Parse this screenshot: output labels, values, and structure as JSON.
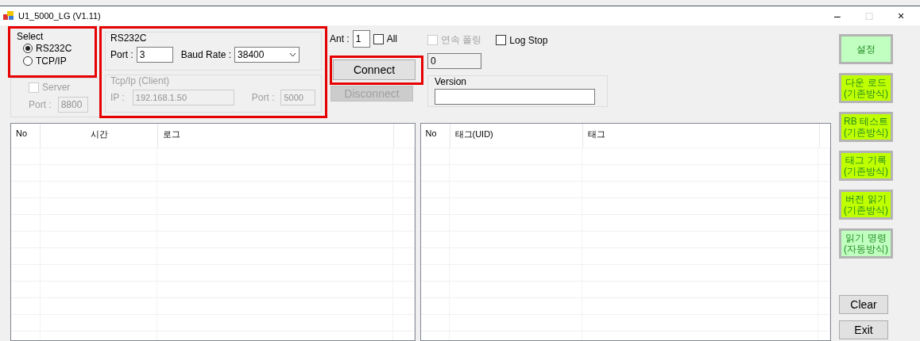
{
  "window": {
    "title": "U1_5000_LG (V1.11)",
    "controls": [
      "–",
      "□",
      "×"
    ]
  },
  "select_group": {
    "title": "Select",
    "highlighted": true,
    "options": [
      {
        "label": "RS232C",
        "selected": true
      },
      {
        "label": "TCP/IP",
        "selected": false
      }
    ]
  },
  "server_group": {
    "disabled": true,
    "server": {
      "label": "Server",
      "checked": false
    },
    "port_label": "Port :",
    "port": "8800"
  },
  "rs232c_group": {
    "highlighted": true,
    "title": "RS232C",
    "port_label": "Port :",
    "port": "3",
    "baud_label": "Baud Rate :",
    "baud": "38400"
  },
  "tcpip_group": {
    "title": "Tcp/Ip (Client)",
    "disabled": true,
    "ip_label": "IP :",
    "ip": "192.168.1.50",
    "port_label": "Port :",
    "port": "5000"
  },
  "ant": {
    "label": "Ant :",
    "value": "1"
  },
  "all": {
    "label": "All",
    "checked": false
  },
  "connect": {
    "label": "Connect",
    "highlighted": true,
    "disabled": false
  },
  "disconnect": {
    "label": "Disconnect",
    "disabled": true
  },
  "polling": {
    "label": "연속 폴링",
    "checked": false,
    "disabled": true
  },
  "log_stop": {
    "label": "Log Stop",
    "checked": false
  },
  "counter": "0",
  "version_group": {
    "title": "Version"
  },
  "log_table": {
    "columns": [
      "No",
      "시간",
      "로그"
    ]
  },
  "tag_table": {
    "columns": [
      "No",
      "태그(UID)",
      "태그"
    ]
  },
  "side_buttons": [
    {
      "lines": [
        "설정"
      ],
      "color": "#c0ffc0"
    },
    {
      "lines": [
        "다운 로드",
        "(기존방식)"
      ],
      "color": "#c0ff00"
    },
    {
      "lines": [
        "RB 테스트",
        "(기존방식)"
      ],
      "color": "#c0ff00"
    },
    {
      "lines": [
        "태그 기록",
        "(기존방식)"
      ],
      "color": "#c0ff00"
    },
    {
      "lines": [
        "버전 읽기",
        "(기존방식)"
      ],
      "color": "#c0ff00"
    },
    {
      "lines": [
        "읽기 명령",
        "(자동방식)"
      ],
      "color": "#c0ffc0"
    }
  ],
  "clear": "Clear",
  "exit": "Exit"
}
